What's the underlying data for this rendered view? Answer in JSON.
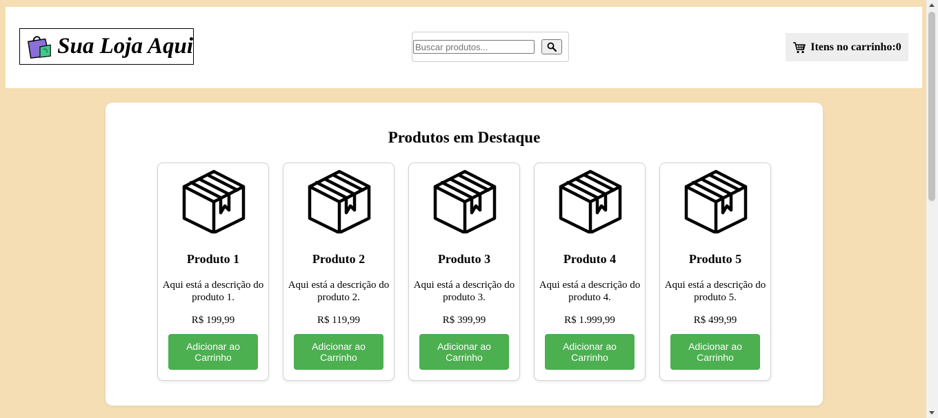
{
  "header": {
    "logo_text": "Sua Loja Aqui",
    "logo_icon": "shopping-bag-icon",
    "search": {
      "placeholder": "Buscar produtos...",
      "value": "",
      "button_icon": "search-icon"
    },
    "cart": {
      "icon": "cart-icon",
      "label": "Itens no carrinho:0"
    }
  },
  "main": {
    "title": "Produtos em Destaque",
    "products": [
      {
        "name": "Produto 1",
        "description": "Aqui está a descrição do produto 1.",
        "price": "R$ 199,99",
        "button_label": "Adicionar ao Carrinho",
        "icon": "box-icon"
      },
      {
        "name": "Produto 2",
        "description": "Aqui está a descrição do produto 2.",
        "price": "R$ 119,99",
        "button_label": "Adicionar ao Carrinho",
        "icon": "box-icon"
      },
      {
        "name": "Produto 3",
        "description": "Aqui está a descrição do produto 3.",
        "price": "R$ 399,99",
        "button_label": "Adicionar ao Carrinho",
        "icon": "box-icon"
      },
      {
        "name": "Produto 4",
        "description": "Aqui está a descrição do produto 4.",
        "price": "R$ 1.999,99",
        "button_label": "Adicionar ao Carrinho",
        "icon": "box-icon"
      },
      {
        "name": "Produto 5",
        "description": "Aqui está a descrição do produto 5.",
        "price": "R$ 499,99",
        "button_label": "Adicionar ao Carrinho",
        "icon": "box-icon"
      }
    ]
  },
  "colors": {
    "page_background": "#f5deb3",
    "button_green": "#4caf50",
    "panel_background": "#ffffff",
    "cart_background": "#eeeeee"
  }
}
